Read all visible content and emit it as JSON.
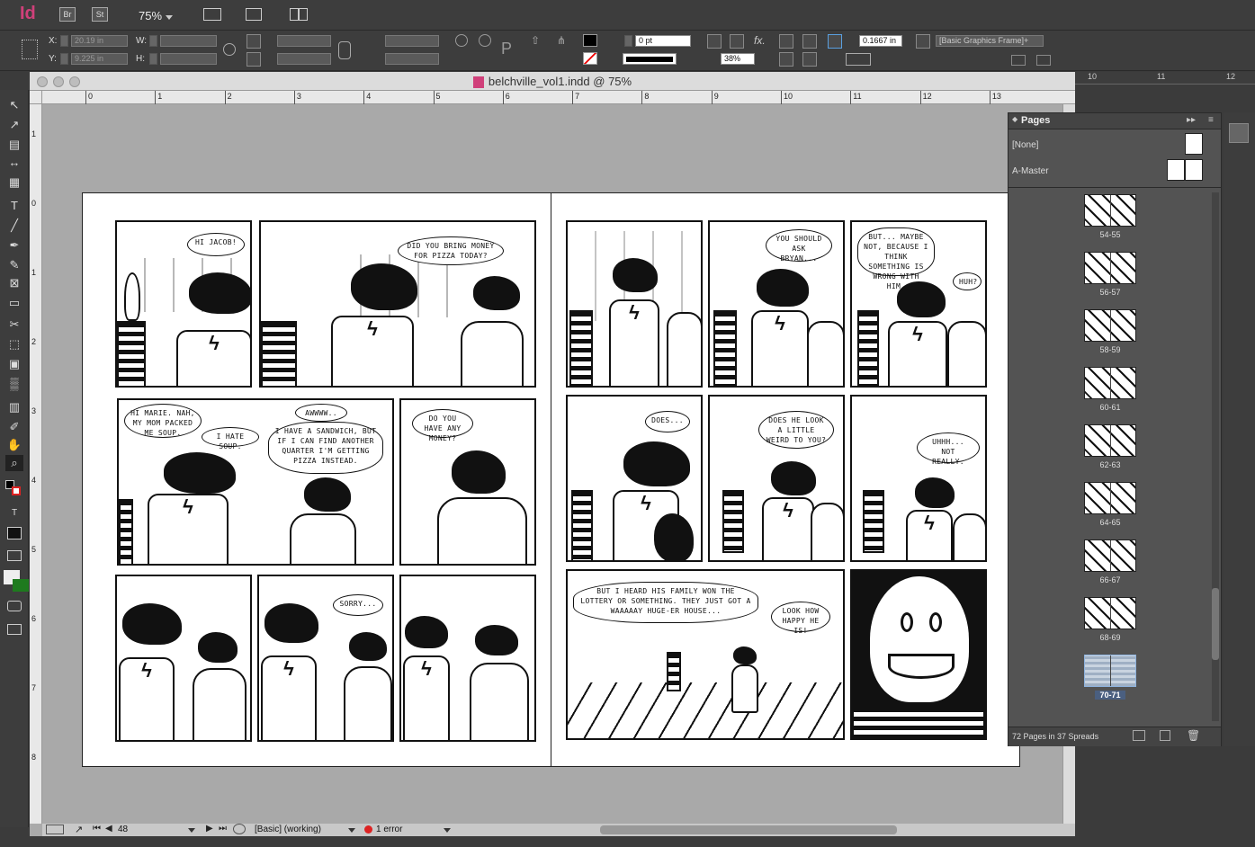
{
  "app": {
    "logo": "Id",
    "bridge": "Br",
    "stock": "St",
    "zoom": "75%"
  },
  "control": {
    "x_label": "X:",
    "y_label": "Y:",
    "w_label": "W:",
    "h_label": "H:",
    "x_value": "20.19 in",
    "y_value": "9.225 in",
    "stroke_weight": "0 pt",
    "opacity": "38%",
    "fitting_value": "0.1667 in",
    "object_style": "[Basic Graphics Frame]+"
  },
  "document": {
    "title": "belchville_vol1.indd @ 75%",
    "h_ruler_ticks": [
      "0",
      "1",
      "2",
      "3",
      "4",
      "5",
      "6",
      "7",
      "8",
      "9",
      "10",
      "11",
      "12",
      "13"
    ],
    "h_ruler_ticks_right": [
      "10",
      "11",
      "12"
    ],
    "v_ruler_ticks": [
      "1",
      "0",
      "1",
      "2",
      "3",
      "4",
      "5",
      "6",
      "7",
      "8"
    ]
  },
  "comic": {
    "left": {
      "p1_bubble": "HI JACOB!",
      "p2_bubble": "DID YOU BRING MONEY FOR PIZZA TODAY?",
      "p3_bubble1": "HI MARIE. NAH, MY MOM PACKED ME SOUP.",
      "p3_bubble2": "I HATE SOUP.",
      "p4_bubble1": "AWWWW..",
      "p4_bubble2": "I HAVE A SANDWICH, BUT IF I CAN FIND ANOTHER QUARTER I'M GETTING PIZZA INSTEAD.",
      "p5_bubble": "DO YOU HAVE ANY MONEY?",
      "p7_bubble": "SORRY..."
    },
    "right": {
      "p2_bubble": "YOU SHOULD ASK BRYAN...",
      "p3_bubble1": "BUT... MAYBE NOT, BECAUSE I THINK SOMETHING IS WRONG WITH HIM.",
      "p3_bubble2": "HUH?",
      "p4_bubble": "DOES...",
      "p5_bubble": "DOES HE LOOK A LITTLE WEIRD TO YOU?",
      "p6_bubble": "UHHH... NOT REALLY.",
      "p7_bubble1": "BUT I HEARD HIS FAMILY WON THE LOTTERY OR SOMETHING. THEY JUST GOT A WAAAAAY HUGE-ER HOUSE...",
      "p7_bubble2": "LOOK HOW HAPPY HE IS!"
    }
  },
  "pages_panel": {
    "title": "Pages",
    "masters": [
      "[None]",
      "A-Master"
    ],
    "spreads": [
      "54-55",
      "56-57",
      "58-59",
      "60-61",
      "62-63",
      "64-65",
      "66-67",
      "68-69",
      "70-71"
    ],
    "selected": "70-71",
    "footer": "72 Pages in 37 Spreads"
  },
  "status": {
    "page_number": "48",
    "style": "[Basic] (working)",
    "errors": "1 error"
  }
}
